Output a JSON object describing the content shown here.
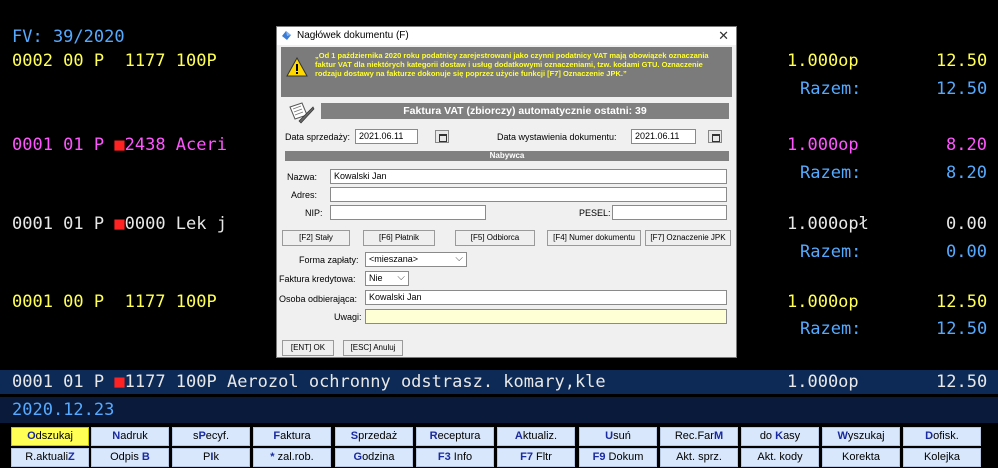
{
  "terminal": {
    "line1": "FV: 39/2020",
    "row1": {
      "code": "0002 00 P  1177 100P",
      "qty": "1.000op",
      "price": "12.50"
    },
    "sum1": {
      "label": "Razem:",
      "value": "12.50"
    },
    "row2": {
      "code": "0001 01 P ",
      "code2": "2438 Aceri",
      "qty": "1.000op",
      "price": "8.20"
    },
    "sum2": {
      "label": "Razem:",
      "value": "8.20"
    },
    "row3": {
      "code": "0001 01 P ",
      "code2": "0000 Lek j",
      "qty": "1.000opł",
      "price": "0.00"
    },
    "sum3": {
      "label": "Razem:",
      "value": "0.00"
    },
    "row4": {
      "code": "0001 00 P  1177 100P",
      "qty": "1.000op",
      "price": "12.50"
    },
    "sum4": {
      "label": "Razem:",
      "value": "12.50"
    },
    "selected": {
      "code": "0001 01 P ",
      "rest": "1177 100P Aerozol ochronny odstrasz. komary,kle",
      "qty": "1.000op",
      "price": "12.50"
    },
    "date": "2020.12.23",
    "marker": "■"
  },
  "dialog": {
    "title": "Nagłówek dokumentu (F)",
    "close": "✕",
    "warning": "„Od 1 października 2020 roku podatnicy zarejestrowani jako czynni podatnicy VAT mają obowiązek oznaczania faktur VAT dla niektórych kategorii dostaw i usług dodatkowymi oznaczeniami, tzw. kodami GTU. Oznaczenie rodzaju dostawy na fakturze dokonuje się poprzez użycie funkcji [F7] Oznaczenie JPK.”",
    "header": "Faktura VAT (zbiorczy)  automatycznie ostatni: 39",
    "sale_date_label": "Data sprzedaży:",
    "sale_date": "2021.06.11",
    "issue_date_label": "Data wystawienia dokumentu:",
    "issue_date": "2021.06.11",
    "buyer_header": "Nabywca",
    "name_label": "Nazwa:",
    "name_value": "Kowalski Jan",
    "address_label": "Adres:",
    "address_value": "",
    "nip_label": "NIP:",
    "nip_value": "",
    "pesel_label": "PESEL:",
    "pesel_value": "",
    "buttons": [
      "[F2] Stały",
      "[F6] Płatnik",
      "[F5] Odbiorca",
      "[F4] Numer dokumentu",
      "[F7] Oznaczenie JPK"
    ],
    "payment_label": "Forma zapłaty:",
    "payment_value": "<mieszana>",
    "credit_label": "Faktura kredytowa:",
    "credit_value": "Nie",
    "recipient_label": "Osoba odbierająca:",
    "recipient_value": "Kowalski Jan",
    "notes_label": "Uwagi:",
    "notes_value": "",
    "ok": "[ENT] OK",
    "cancel": "[ESC] Anuluj"
  },
  "fkeys_row1": [
    {
      "pre": "",
      "hot": "O",
      "post": "dszukaj"
    },
    {
      "pre": "",
      "hot": "N",
      "post": "adruk"
    },
    {
      "pre": "s",
      "hot": "P",
      "post": "ecyf."
    },
    {
      "pre": "",
      "hot": "F",
      "post": "aktura"
    },
    {
      "pre": "",
      "hot": "S",
      "post": "przedaż"
    },
    {
      "pre": "",
      "hot": "R",
      "post": "eceptura"
    },
    {
      "pre": "",
      "hot": "A",
      "post": "ktualiz."
    },
    {
      "pre": "",
      "hot": "U",
      "post": "suń"
    },
    {
      "pre": "Rec.Far",
      "hot": "M",
      "post": ""
    },
    {
      "pre": "do ",
      "hot": "K",
      "post": "asy"
    },
    {
      "pre": "",
      "hot": "W",
      "post": "yszukaj"
    },
    {
      "pre": "",
      "hot": "D",
      "post": "ofisk."
    }
  ],
  "fkeys_row2": [
    {
      "pre": "R.aktuali",
      "hot": "Z",
      "post": ""
    },
    {
      "pre": "Odpis ",
      "hot": "B",
      "post": ""
    },
    {
      "pre": "P",
      "hot": "I",
      "post": "k"
    },
    {
      "pre": "",
      "hot": "*",
      "post": " zal.rob."
    },
    {
      "pre": "",
      "hot": "G",
      "post": "odzina"
    },
    {
      "pre": "",
      "hot": "F3",
      "post": " Info"
    },
    {
      "pre": "",
      "hot": "F7",
      "post": " Fltr"
    },
    {
      "pre": "",
      "hot": "F9",
      "post": " Dokum"
    },
    {
      "pre": "Akt. sprz.",
      "hot": "",
      "post": ""
    },
    {
      "pre": "Akt. kody",
      "hot": "",
      "post": ""
    },
    {
      "pre": "Korekta",
      "hot": "",
      "post": ""
    },
    {
      "pre": "Kolejka",
      "hot": "",
      "post": ""
    }
  ],
  "colors": {
    "hotkey": "#1a2aa0",
    "active_key": "#ffff55",
    "terminal_bg": "#000000"
  }
}
